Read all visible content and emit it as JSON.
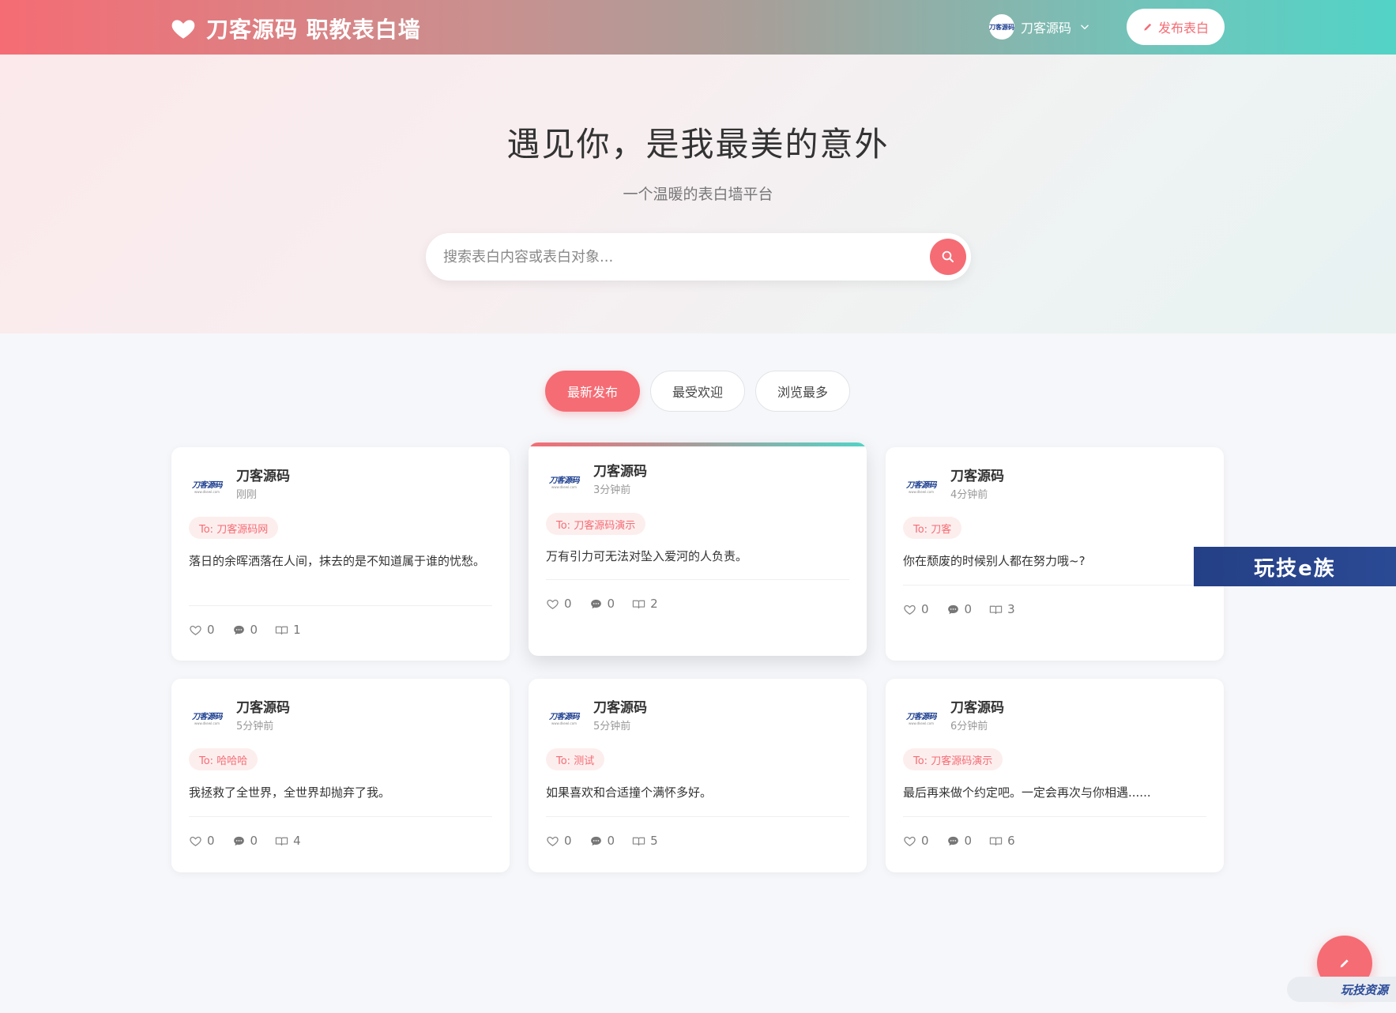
{
  "header": {
    "brand_title": "刀客源码 职教表白墙",
    "user_name": "刀客源码",
    "publish_label": "发布表白"
  },
  "hero": {
    "title": "遇见你，是我最美的意外",
    "subtitle": "一个温暖的表白墙平台",
    "search_placeholder": "搜索表白内容或表白对象..."
  },
  "tabs": [
    {
      "label": "最新发布",
      "active": true
    },
    {
      "label": "最受欢迎",
      "active": false
    },
    {
      "label": "浏览最多",
      "active": false
    }
  ],
  "cards": [
    {
      "author": "刀客源码",
      "time": "刚刚",
      "to": "To: 刀客源码网",
      "content": "落日的余晖洒落在人间，抹去的是不知道属于谁的忧愁。",
      "likes": "0",
      "comments": "0",
      "views": "1"
    },
    {
      "author": "刀客源码",
      "time": "3分钟前",
      "to": "To: 刀客源码演示",
      "content": "万有引力可无法对坠入爱河的人负责。",
      "likes": "0",
      "comments": "0",
      "views": "2"
    },
    {
      "author": "刀客源码",
      "time": "4分钟前",
      "to": "To: 刀客",
      "content": "你在颓废的时候别人都在努力哦~?",
      "likes": "0",
      "comments": "0",
      "views": "3"
    },
    {
      "author": "刀客源码",
      "time": "5分钟前",
      "to": "To: 哈哈哈",
      "content": "我拯救了全世界，全世界却抛弃了我。",
      "likes": "0",
      "comments": "0",
      "views": "4"
    },
    {
      "author": "刀客源码",
      "time": "5分钟前",
      "to": "To: 测试",
      "content": "如果喜欢和合适撞个满怀多好。",
      "likes": "0",
      "comments": "0",
      "views": "5"
    },
    {
      "author": "刀客源码",
      "time": "6分钟前",
      "to": "To: 刀客源码演示",
      "content": "最后再来做个约定吧。一定会再次与你相遇......",
      "likes": "0",
      "comments": "0",
      "views": "6"
    }
  ],
  "logo": {
    "text": "刀客源码",
    "url": "www.dkewl.com"
  },
  "watermarks": {
    "banner": "玩技e族",
    "corner": "玩技资源"
  },
  "colors": {
    "accent": "#f56c74",
    "teal": "#52d3c6"
  }
}
